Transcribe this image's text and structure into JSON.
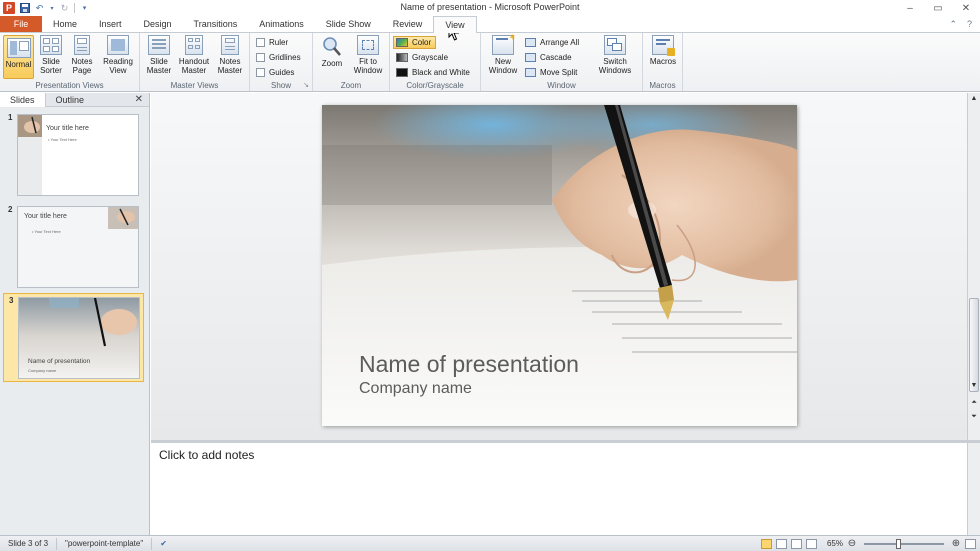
{
  "app": {
    "window_title": "Name of presentation - Microsoft PowerPoint",
    "logo_letter": "P"
  },
  "tabs": [
    {
      "label": "File"
    },
    {
      "label": "Home"
    },
    {
      "label": "Insert"
    },
    {
      "label": "Design"
    },
    {
      "label": "Transitions"
    },
    {
      "label": "Animations"
    },
    {
      "label": "Slide Show"
    },
    {
      "label": "Review"
    },
    {
      "label": "View"
    }
  ],
  "ribbon": {
    "presentation_views": {
      "label": "Presentation Views",
      "normal": "Normal",
      "slide_sorter_1": "Slide",
      "slide_sorter_2": "Sorter",
      "notes_page_1": "Notes",
      "notes_page_2": "Page",
      "reading_view_1": "Reading",
      "reading_view_2": "View"
    },
    "master_views": {
      "label": "Master Views",
      "slide_master_1": "Slide",
      "slide_master_2": "Master",
      "handout_master_1": "Handout",
      "handout_master_2": "Master",
      "notes_master_1": "Notes",
      "notes_master_2": "Master"
    },
    "show": {
      "label": "Show",
      "ruler": "Ruler",
      "gridlines": "Gridlines",
      "guides": "Guides"
    },
    "zoom": {
      "label": "Zoom",
      "zoom": "Zoom",
      "fit_1": "Fit to",
      "fit_2": "Window"
    },
    "color": {
      "label": "Color/Grayscale",
      "color": "Color",
      "grayscale": "Grayscale",
      "bw": "Black and White"
    },
    "window": {
      "label": "Window",
      "new_window_1": "New",
      "new_window_2": "Window",
      "arrange_all": "Arrange All",
      "cascade": "Cascade",
      "move_split": "Move Split",
      "switch_1": "Switch",
      "switch_2": "Windows"
    },
    "macros": {
      "label": "Macros",
      "macros": "Macros"
    }
  },
  "left_pane": {
    "tab_slides": "Slides",
    "tab_outline": "Outline",
    "thumbs": [
      {
        "num": "1",
        "title": "Your title here",
        "text": "• Your Text Here"
      },
      {
        "num": "2",
        "title": "Your title here",
        "text": "• Your Text Here"
      },
      {
        "num": "3",
        "title": "Name of presentation",
        "text": "Company name"
      }
    ]
  },
  "slide": {
    "title": "Name of presentation",
    "subtitle": "Company name"
  },
  "notes": {
    "placeholder": "Click to add notes"
  },
  "status": {
    "slide_info": "Slide 3 of 3",
    "theme": "\"powerpoint-template\"",
    "zoom": "65%"
  },
  "colors": {
    "file_tab": "#d55a2a",
    "active_highlight": "#f8cb5a"
  }
}
